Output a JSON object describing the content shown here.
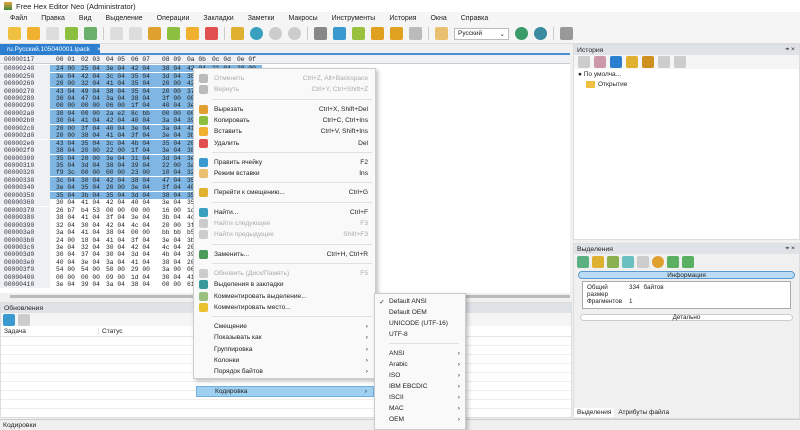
{
  "window": {
    "title": "Free Hex Editor Neo (Administrator)"
  },
  "menu": [
    "Файл",
    "Правка",
    "Вид",
    "Выделение",
    "Операции",
    "Закладки",
    "Заметки",
    "Макросы",
    "Инструменты",
    "История",
    "Окна",
    "Справка"
  ],
  "toolbar": {
    "language": "Русский"
  },
  "tab": {
    "label": "ru.Русский.105040001.lpack",
    "close": "×"
  },
  "hex": {
    "header_offset": "00000117",
    "header_cols": [
      "00 01",
      "02 03",
      "04 05",
      "06 07",
      "08 09",
      "0a 0b",
      "0c 0d",
      "0e 0f"
    ],
    "first_row_extra": [
      "21 04",
      "20 00"
    ],
    "selected_rows": 18,
    "rows": [
      [
        "00000240",
        "24 00",
        "25 04",
        "3e 04",
        "42 04",
        "38 04",
        "42 04"
      ],
      [
        "00000250",
        "3e 04",
        "42 04",
        "3c 04",
        "35 04",
        "3d 04",
        "38 0"
      ],
      [
        "00000260",
        "20 00",
        "32 04",
        "41 04",
        "35 04",
        "20 00",
        "42 0"
      ],
      [
        "00000270",
        "43 04",
        "49 04",
        "38 04",
        "35 04",
        "20 00",
        "37 0"
      ],
      [
        "00000280",
        "30 04",
        "47 04",
        "3a 04",
        "38 04",
        "3f 00",
        "00 0"
      ],
      [
        "00000290",
        "00 00",
        "00 00",
        "06 00",
        "1f 04",
        "40 04",
        "3e 0"
      ],
      [
        "000002a0",
        "38 04",
        "00 00",
        "2a e2",
        "8c bb",
        "00 00",
        "00 0"
      ],
      [
        "000002b0",
        "30 04",
        "41 04",
        "42 04",
        "40 04",
        "3a 04",
        "39 0"
      ],
      [
        "000002c0",
        "20 00",
        "3f 04",
        "40 04",
        "3e 04",
        "3a 04",
        "41 0"
      ],
      [
        "000002d0",
        "20 00",
        "38 04",
        "41 04",
        "3f 04",
        "3e 04",
        "3b 0"
      ],
      [
        "000002e0",
        "43 04",
        "35 04",
        "3c 04",
        "4b 04",
        "35 04",
        "20 0"
      ],
      [
        "000002f0",
        "38 04",
        "20 00",
        "22 00",
        "1f 04",
        "3e 04",
        "38 0"
      ],
      [
        "00000300",
        "35 04",
        "20 00",
        "3e 04",
        "31 04",
        "3d 04",
        "3e 0"
      ],
      [
        "00000310",
        "35 04",
        "3d 04",
        "38 04",
        "39 04",
        "22 00",
        "3a 0"
      ],
      [
        "00000320",
        "f9 3c",
        "00 00",
        "00 00",
        "23 00",
        "10 04",
        "32 0"
      ],
      [
        "00000330",
        "3c 04",
        "30 04",
        "42 04",
        "38 04",
        "47 04",
        "35 0"
      ],
      [
        "00000340",
        "3e 04",
        "35 04",
        "20 00",
        "3e 04",
        "3f 04",
        "40 0"
      ],
      [
        "00000350",
        "35 04",
        "3b 04",
        "35 04",
        "3d 04",
        "38 04",
        "35 0"
      ],
      [
        "00000360",
        "30 04",
        "41 04",
        "42 04",
        "40 04",
        "3e 04",
        "35 0"
      ],
      [
        "00000370",
        "26 b7",
        "b4 53",
        "00 00",
        "00 00",
        "16 00",
        "1d 0"
      ],
      [
        "00000380",
        "38 04",
        "41 04",
        "3f 04",
        "3e 04",
        "3b 04",
        "4c 0"
      ],
      [
        "00000390",
        "32 04",
        "30 04",
        "42 04",
        "4c 04",
        "20 00",
        "3f 0"
      ],
      [
        "000003a0",
        "3a 04",
        "41 04",
        "38 04",
        "00 00",
        "bb bb",
        "b5 1"
      ],
      [
        "000003b0",
        "24 00",
        "18 04",
        "41 04",
        "3f 04",
        "3e 04",
        "3b 0"
      ],
      [
        "000003c0",
        "3e 04",
        "32 04",
        "30 04",
        "42 04",
        "4c 04",
        "20 0"
      ],
      [
        "000003d0",
        "30 04",
        "37 04",
        "30 04",
        "3d 04",
        "4b 04",
        "39 0"
      ],
      [
        "000003e0",
        "40 04",
        "3e 04",
        "3a 04",
        "41 04",
        "38 04",
        "20 0"
      ],
      [
        "000003f0",
        "54 00",
        "54 00",
        "50 00",
        "29 00",
        "3a 00",
        "00 0"
      ],
      [
        "00000400",
        "00 00",
        "00 00",
        "09 00",
        "1d 04",
        "30 04",
        "41 0"
      ],
      [
        "00000410",
        "3e 04",
        "39 04",
        "3a 04",
        "38 04",
        "00 00",
        "61 0"
      ]
    ]
  },
  "updates": {
    "title": "Обновления",
    "columns": [
      "Задача",
      "Статус"
    ]
  },
  "status": {
    "text": "Кодировки"
  },
  "history": {
    "title": "История",
    "root": "По умолча...",
    "item": "Открытие"
  },
  "selection": {
    "title": "Выделения",
    "info_header": "Информация",
    "total_label": "Общий размер",
    "total_value": "334",
    "total_unit": "байтов",
    "frag_label": "Фрагментов",
    "frag_value": "1",
    "details": "Детально",
    "tabs": [
      "Выделения",
      "Атрибуты файла"
    ]
  },
  "context_menu": [
    {
      "label": "Отменить",
      "shortcut": "Ctrl+Z, Alt+Backspace",
      "disabled": true,
      "icon": "undo-icon",
      "color": "#bbb"
    },
    {
      "label": "Вернуть",
      "shortcut": "Ctrl+Y, Ctrl+Shift+Z",
      "disabled": true,
      "icon": "redo-icon",
      "color": "#bbb"
    },
    {
      "sep": true
    },
    {
      "label": "Вырезать",
      "shortcut": "Ctrl+X, Shift+Del",
      "icon": "cut-icon",
      "color": "#e0a030"
    },
    {
      "label": "Копировать",
      "shortcut": "Ctrl+C, Ctrl+Ins",
      "icon": "copy-icon",
      "color": "#8cbf3f"
    },
    {
      "label": "Вставить",
      "shortcut": "Ctrl+V, Shift+Ins",
      "icon": "paste-icon",
      "color": "#f0b030"
    },
    {
      "label": "Удалить",
      "shortcut": "Del",
      "icon": "delete-icon",
      "color": "#e05050"
    },
    {
      "sep": true
    },
    {
      "label": "Править ячейку",
      "shortcut": "F2",
      "icon": "edit-icon",
      "color": "#3a9ad0"
    },
    {
      "label": "Режим вставки",
      "shortcut": "Ins",
      "icon": "insert-mode-icon",
      "color": "#e8c070"
    },
    {
      "sep": true
    },
    {
      "label": "Перейти к смещению...",
      "shortcut": "Ctrl+G",
      "icon": "goto-icon",
      "color": "#e0b030"
    },
    {
      "sep": true
    },
    {
      "label": "Найти...",
      "shortcut": "Ctrl+F",
      "icon": "find-icon",
      "color": "#3aa0c0"
    },
    {
      "label": "Найти следующее",
      "shortcut": "F3",
      "disabled": true,
      "icon": "find-next-icon",
      "color": "#ccc"
    },
    {
      "label": "Найти предыдущее",
      "shortcut": "Shift+F3",
      "disabled": true,
      "icon": "find-prev-icon",
      "color": "#ccc"
    },
    {
      "sep": true
    },
    {
      "label": "Заменить...",
      "shortcut": "Ctrl+H, Ctrl+R",
      "icon": "replace-icon",
      "color": "#4a9a5a"
    },
    {
      "sep": true
    },
    {
      "label": "Обновить (Диск/Память)",
      "shortcut": "F5",
      "disabled": true,
      "icon": "refresh-icon",
      "color": "#ccc"
    },
    {
      "label": "Выделения в закладки",
      "shortcut": "",
      "icon": "bookmark-icon",
      "color": "#3a9a9a"
    },
    {
      "label": "Комментировать выделение...",
      "shortcut": "",
      "icon": "comment-icon",
      "color": "#9ac080"
    },
    {
      "label": "Комментировать место...",
      "shortcut": "",
      "icon": "note-icon",
      "color": "#e8c030"
    },
    {
      "sep": true
    },
    {
      "label": "Смещение",
      "submenu": true
    },
    {
      "label": "Показывать как",
      "submenu": true
    },
    {
      "label": "Группировка",
      "submenu": true
    },
    {
      "label": "Колонки",
      "submenu": true
    },
    {
      "label": "Порядок байтов",
      "submenu": true
    },
    {
      "sep": true
    },
    {
      "label": "Кодировка",
      "submenu": true,
      "highlighted": true
    }
  ],
  "encoding_menu": [
    {
      "label": "Default ANSI",
      "checked": true
    },
    {
      "label": "Default OEM"
    },
    {
      "label": "UNICODE (UTF-16)"
    },
    {
      "label": "UTF-8"
    },
    {
      "sep": true
    },
    {
      "label": "ANSI",
      "submenu": true
    },
    {
      "label": "Arabic",
      "submenu": true
    },
    {
      "label": "ISO",
      "submenu": true
    },
    {
      "label": "IBM EBCDIC",
      "submenu": true
    },
    {
      "label": "ISCII",
      "submenu": true
    },
    {
      "label": "MAC",
      "submenu": true
    },
    {
      "label": "OEM",
      "submenu": true
    }
  ],
  "glyphs": {
    "check": "✓",
    "arrow": "›",
    "bullet": "●"
  }
}
